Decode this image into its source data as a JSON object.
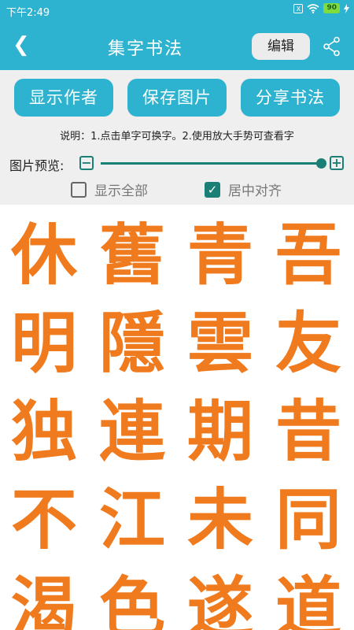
{
  "status_bar": {
    "time": "下午2:49",
    "sim": "X",
    "battery": "90"
  },
  "app_bar": {
    "back_glyph": "❮",
    "title": "集字书法",
    "edit_label": "编辑",
    "share_icon": "share-icon"
  },
  "buttons": {
    "show_author": "显示作者",
    "save_image": "保存图片",
    "share": "分享书法"
  },
  "instruction": "说明：1.点击单字可换字。2.使用放大手势可查看字",
  "preview": {
    "label": "图片预览:",
    "minus": "−",
    "plus": "+",
    "level": 0.98
  },
  "options": {
    "show_all": {
      "label": "显示全部",
      "checked": false
    },
    "center_align": {
      "label": "居中对齐",
      "checked": true
    }
  },
  "characters": [
    "休",
    "舊",
    "青",
    "吾",
    "明",
    "隱",
    "雲",
    "友",
    "独",
    "連",
    "期",
    "昔",
    "不",
    "江",
    "未",
    "同",
    "渴",
    "色",
    "遂",
    "道"
  ],
  "colors": {
    "primary": "#2db3cf",
    "accent": "#1a7f74",
    "calligraphy": "#f07b1f",
    "panel": "#efefef"
  }
}
